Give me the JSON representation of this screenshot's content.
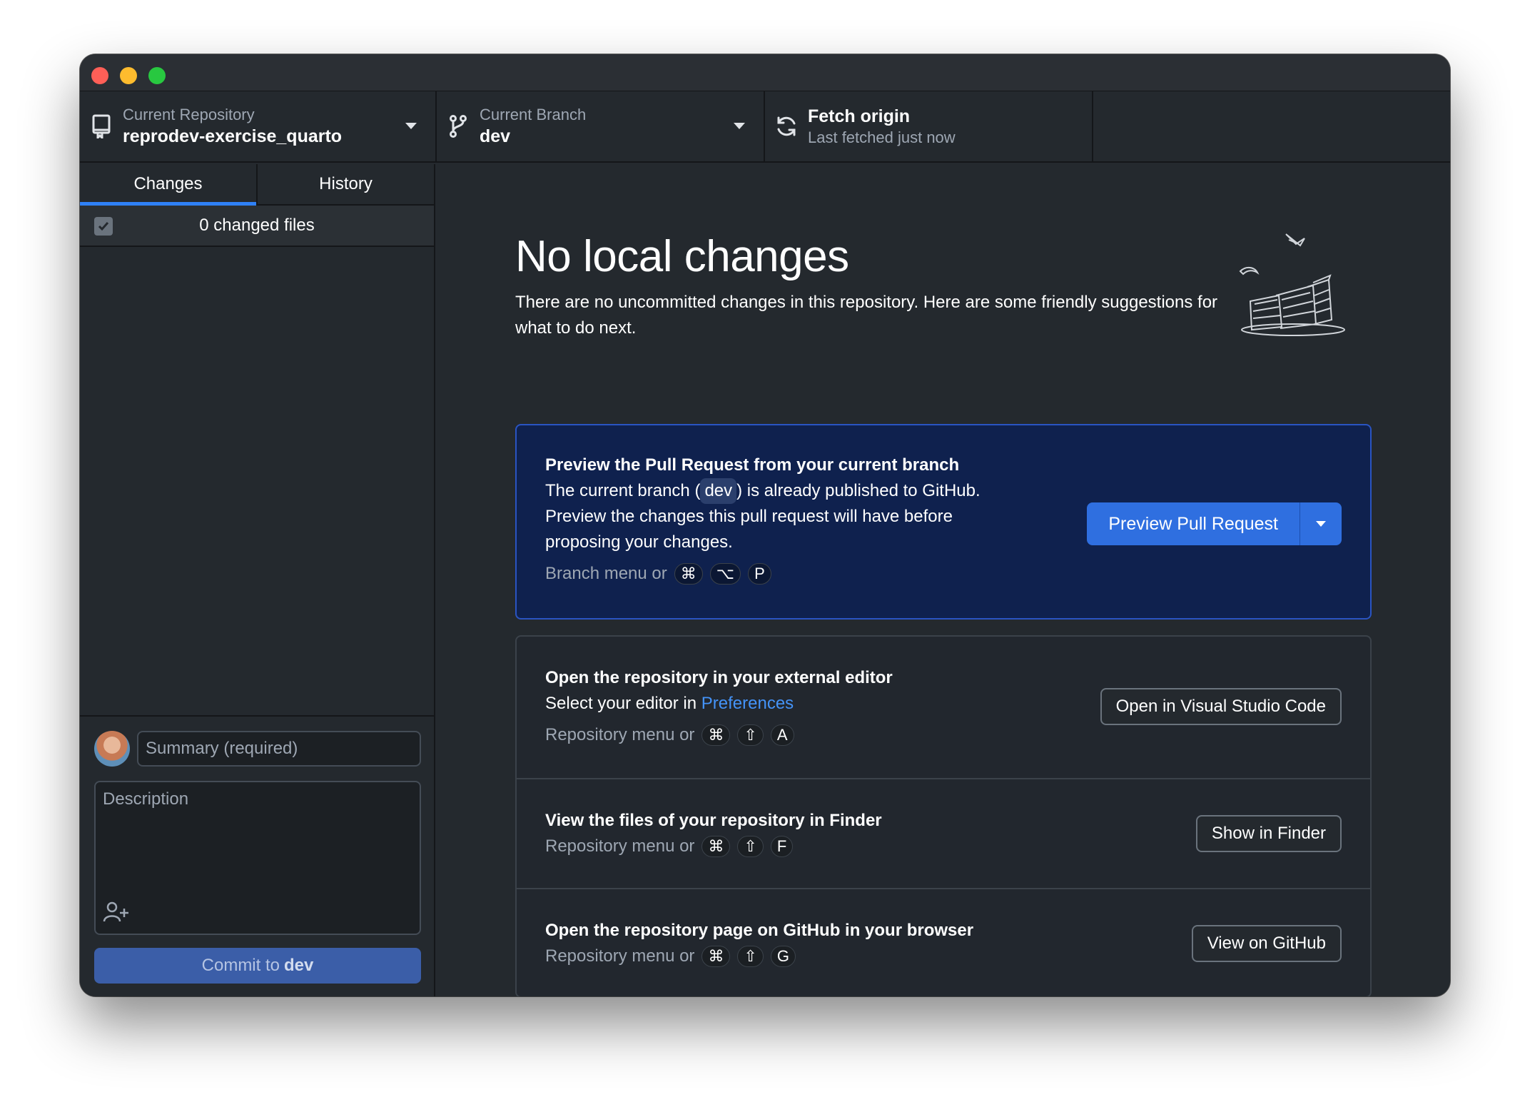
{
  "toolbar": {
    "repo": {
      "label": "Current Repository",
      "value": "reprodev-exercise_quarto"
    },
    "branch": {
      "label": "Current Branch",
      "value": "dev"
    },
    "fetch": {
      "label": "Fetch origin",
      "value": "Last fetched just now"
    }
  },
  "sidebar": {
    "tabs": [
      {
        "label": "Changes",
        "active": true
      },
      {
        "label": "History",
        "active": false
      }
    ],
    "changes_count": "0 changed files",
    "commit": {
      "summary_placeholder": "Summary (required)",
      "description_placeholder": "Description",
      "button_prefix": "Commit to",
      "button_branch": "dev"
    }
  },
  "main": {
    "heading": "No local changes",
    "subtext": "There are no uncommitted changes in this repository. Here are some friendly suggestions for what to do next.",
    "pr_card": {
      "title": "Preview the Pull Request from your current branch",
      "line1_prefix": "The current branch (",
      "line1_branch": "dev",
      "line1_suffix": ") is already published to GitHub.",
      "line2": "Preview the changes this pull request will have before",
      "line3": "proposing your changes.",
      "shortcut_label": "Branch menu or",
      "shortcut_keys": [
        "⌘",
        "⌥",
        "P"
      ],
      "button": "Preview Pull Request"
    },
    "editor_card": {
      "title": "Open the repository in your external editor",
      "line_prefix": "Select your editor in",
      "line_link": "Preferences",
      "shortcut_label": "Repository menu or",
      "shortcut_keys": [
        "⌘",
        "⇧",
        "A"
      ],
      "button": "Open in Visual Studio Code"
    },
    "finder_card": {
      "title": "View the files of your repository in Finder",
      "shortcut_label": "Repository menu or",
      "shortcut_keys": [
        "⌘",
        "⇧",
        "F"
      ],
      "button": "Show in Finder"
    },
    "github_card": {
      "title": "Open the repository page on GitHub in your browser",
      "shortcut_label": "Repository menu or",
      "shortcut_keys": [
        "⌘",
        "⇧",
        "G"
      ],
      "button": "View on GitHub"
    }
  },
  "colors": {
    "accent": "#2f6fe0",
    "link": "#4493f8",
    "background": "#24292e",
    "pr_card_bg": "#0f214e"
  },
  "icons": [
    "repo-icon",
    "branch-icon",
    "sync-icon",
    "caret-down-icon",
    "checkmark-icon",
    "add-coauthor-icon"
  ]
}
